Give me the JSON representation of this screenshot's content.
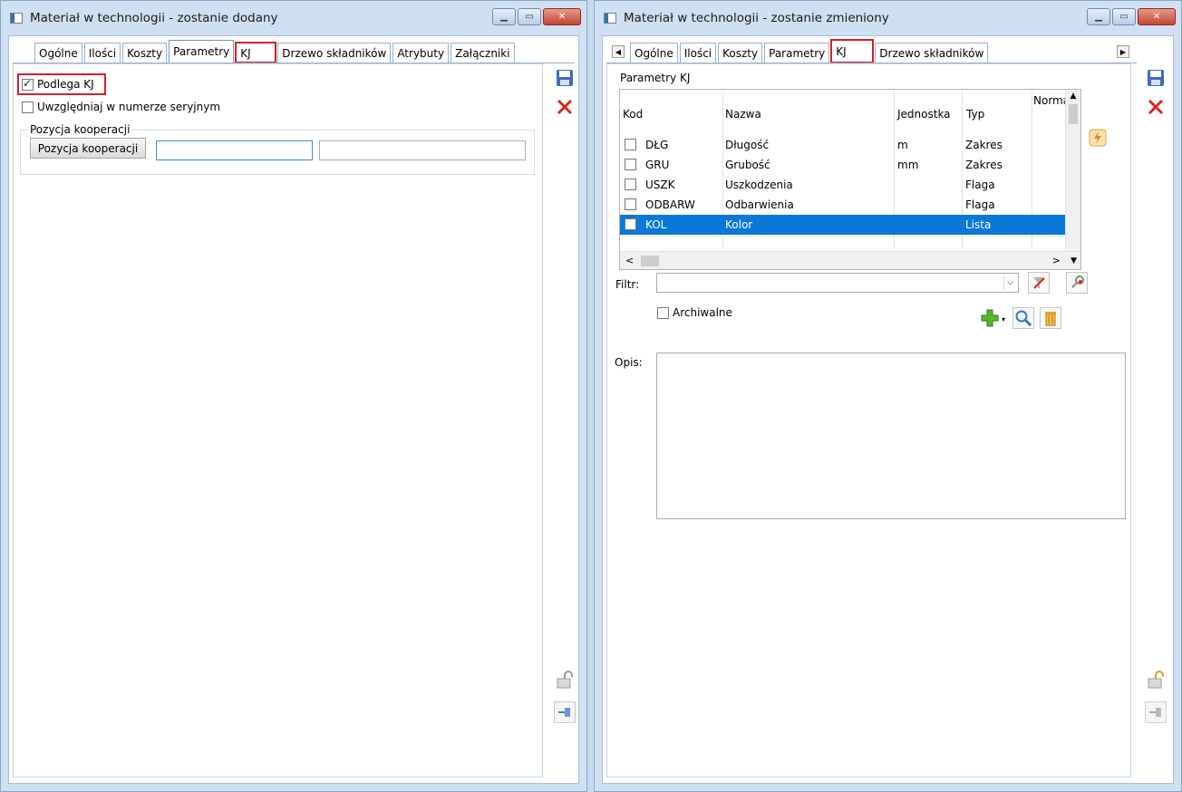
{
  "left_window": {
    "title": "Materiał w technologii - zostanie dodany",
    "tabs": [
      "Ogólne",
      "Ilości",
      "Koszty",
      "Parametry",
      "KJ",
      "Drzewo składników",
      "Atrybuty",
      "Załączniki"
    ],
    "active_tab": "Parametry",
    "highlighted_tab": "KJ",
    "podlega_kj": {
      "label": "Podlega KJ",
      "checked": true
    },
    "serial_checkbox": {
      "label": "Uwzględniaj w numerze seryjnym",
      "checked": false
    },
    "cooperation_group": {
      "title": "Pozycja kooperacji",
      "button_label": "Pozycja kooperacji",
      "field1_value": "",
      "field2_value": ""
    }
  },
  "right_window": {
    "title": "Materiał w technologii - zostanie zmieniony",
    "tabs": [
      "Ogólne",
      "Ilości",
      "Koszty",
      "Parametry",
      "KJ",
      "Drzewo składników"
    ],
    "active_tab": "KJ",
    "group_title": "Parametry KJ",
    "columns": [
      "Kod",
      "Nazwa",
      "Jednostka",
      "Typ",
      "Norma"
    ],
    "rows": [
      {
        "kod": "DŁG",
        "nazwa": "Długość",
        "jednostka": "m",
        "typ": "Zakres",
        "selected": false
      },
      {
        "kod": "GRU",
        "nazwa": "Grubość",
        "jednostka": "mm",
        "typ": "Zakres",
        "selected": false
      },
      {
        "kod": "USZK",
        "nazwa": "Uszkodzenia",
        "jednostka": "",
        "typ": "Flaga",
        "selected": false
      },
      {
        "kod": "ODBARW",
        "nazwa": "Odbarwienia",
        "jednostka": "",
        "typ": "Flaga",
        "selected": false
      },
      {
        "kod": "KOL",
        "nazwa": "Kolor",
        "jednostka": "",
        "typ": "Lista",
        "selected": true
      }
    ],
    "filter_label": "Filtr:",
    "filter_value": "",
    "archival": {
      "label": "Archiwalne",
      "checked": false
    },
    "description_label": "Opis:",
    "description_value": ""
  },
  "colors": {
    "selection": "#0a78d7",
    "highlight_border": "#d21f2b",
    "window_frame": "#cfe0f2"
  }
}
